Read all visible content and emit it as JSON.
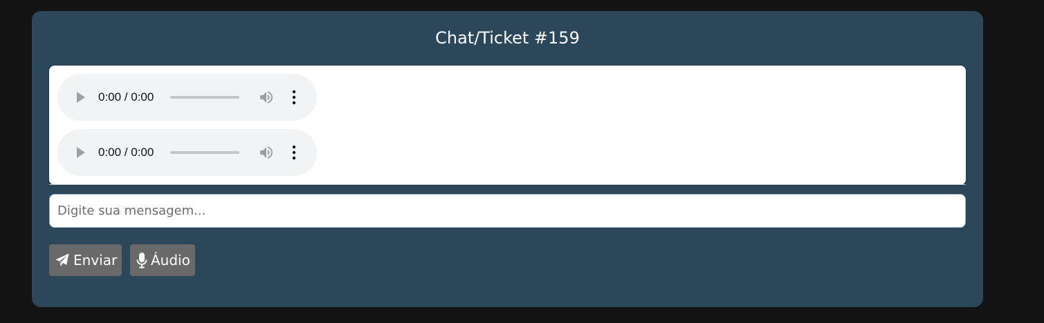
{
  "chat": {
    "title": "Chat/Ticket #159"
  },
  "messages": [
    {
      "type": "audio",
      "time": "0:00 / 0:00",
      "icons": [
        "play-icon",
        "volume-icon",
        "more-options-icon"
      ]
    },
    {
      "type": "audio",
      "time": "0:00 / 0:00",
      "icons": [
        "play-icon",
        "volume-icon",
        "more-options-icon"
      ]
    }
  ],
  "composer": {
    "placeholder": "Digite sua mensagem...",
    "send_label": "Enviar",
    "send_icon": "paper-plane-icon",
    "audio_label": "Áudio",
    "audio_icon": "microphone-icon"
  },
  "colors": {
    "page_background": "#131313",
    "panel_background": "#2b4759",
    "button_background": "#696969",
    "audio_player_background": "#f1f3f4"
  }
}
